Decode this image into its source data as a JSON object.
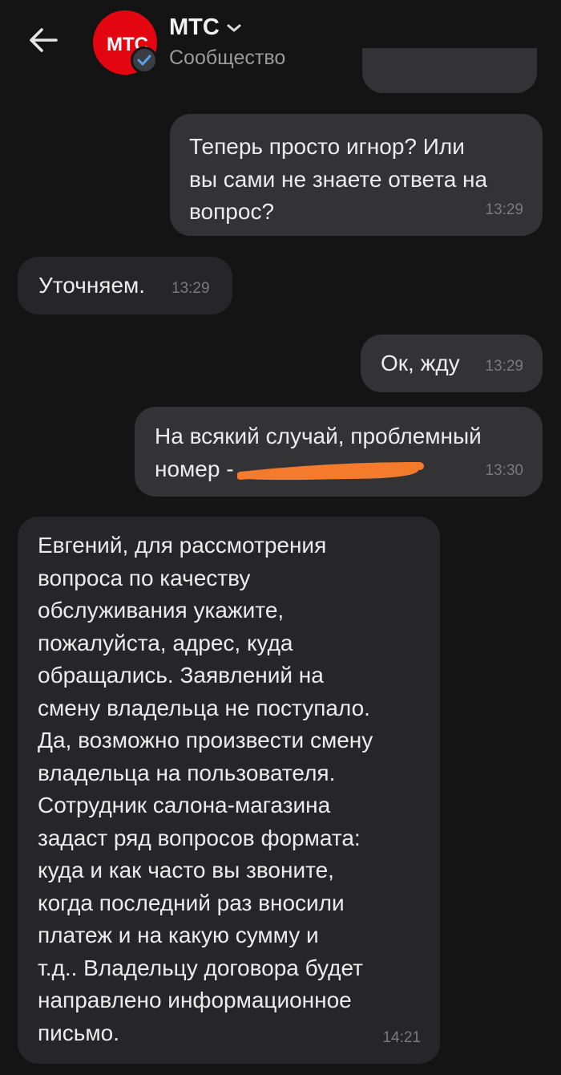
{
  "header": {
    "title": "МТС",
    "subtitle": "Сообщество",
    "avatar_text": "МТС",
    "icons": {
      "back": "arrow-left-icon",
      "dropdown": "chevron-down-icon",
      "verified": "check-badge-icon"
    }
  },
  "messages": [
    {
      "direction": "outgoing",
      "text": "Теперь просто игнор? Или\nвы сами не знаете ответа на\nвопрос?",
      "time": "13:29"
    },
    {
      "direction": "incoming",
      "text": "Уточняем.",
      "time": "13:29"
    },
    {
      "direction": "outgoing",
      "text": "Ок, жду",
      "time": "13:29"
    },
    {
      "direction": "outgoing",
      "text": "На всякий случай, проблемный\nномер -",
      "time": "13:30",
      "redacted": true
    },
    {
      "direction": "incoming",
      "text": "Евгений, для рассмотрения\nвопроса по качеству\nобслуживания укажите,\nпожалуйста, адрес, куда\nобращались. Заявлений на\nсмену владельца не поступало.\nДа, возможно произвести смену\nвладельца на пользователя.\nСотрудник салона-магазина\nзадаст ряд вопросов формата:\nкуда и как часто вы звоните,\nкогда последний раз вносили\nплатеж и на какую сумму и\nт.д.. Владельцу договора будет\nнаправлено информационное\nписьмо.",
      "time": "14:21"
    }
  ],
  "colors": {
    "background": "#141414",
    "bubble_out": "#333336",
    "bubble_in": "#262628",
    "brand_red": "#e30611",
    "redaction": "#f47a2c"
  }
}
